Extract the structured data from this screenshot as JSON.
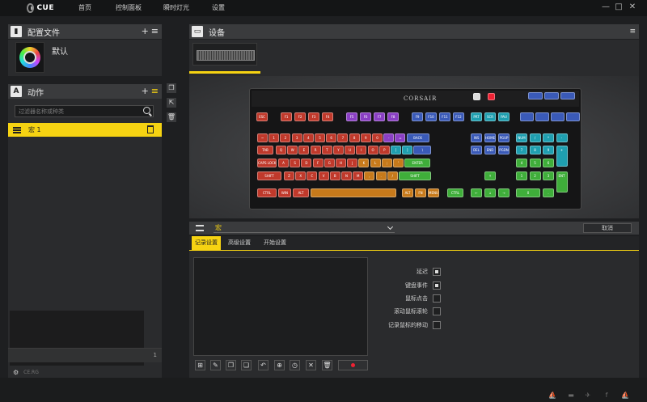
{
  "app": {
    "logo_text": "CUE"
  },
  "nav": {
    "items": [
      "首页",
      "控制面板",
      "瞬时灯光",
      "设置"
    ]
  },
  "window_controls": {
    "minimize": "—",
    "maximize": "□",
    "close": "✕"
  },
  "profiles": {
    "title": "配置文件",
    "add": "+",
    "menu": "≡",
    "selected_profile": "默认"
  },
  "actions": {
    "title": "动作",
    "add": "+",
    "menu": "≡",
    "search_placeholder": "过滤器名称或种类",
    "selected_action": "宏 1",
    "footer_number": "1",
    "footer_label": "CE.RG"
  },
  "devices": {
    "title": "设备",
    "menu": "≡"
  },
  "keyboard": {
    "brand": "CORSAIR",
    "rows": {
      "fn": [
        "ESC",
        "F1",
        "F2",
        "F3",
        "F4",
        "F5",
        "F6",
        "F7",
        "F8",
        "F9",
        "F10",
        "F11",
        "F12",
        "PRT",
        "SCR",
        "PAU"
      ],
      "num": [
        "~",
        "1",
        "2",
        "3",
        "4",
        "5",
        "6",
        "7",
        "8",
        "9",
        "0",
        "-",
        "=",
        "BACK",
        "INS",
        "HOME",
        "PGUP",
        "NUM",
        "/",
        "*",
        "-"
      ],
      "tab": [
        "TAB",
        "Q",
        "W",
        "E",
        "R",
        "T",
        "Y",
        "U",
        "I",
        "O",
        "P",
        "[",
        "]",
        "\\",
        "DEL",
        "END",
        "PGDN",
        "7",
        "8",
        "9",
        "+"
      ],
      "caps": [
        "CAPS LOCK",
        "A",
        "S",
        "D",
        "F",
        "G",
        "H",
        "J",
        "K",
        "L",
        ";",
        "'",
        "ENTER",
        "4",
        "5",
        "6"
      ],
      "shift": [
        "SHIFT",
        "Z",
        "X",
        "C",
        "V",
        "B",
        "N",
        "M",
        ",",
        ".",
        "/",
        "SHIFT",
        "↑",
        "1",
        "2",
        "3",
        "ENT"
      ],
      "ctrl": [
        "CTRL",
        "WIN",
        "ALT",
        "",
        "ALT",
        "FN",
        "MENU",
        "CTRL",
        "←",
        "↓",
        "→",
        "0",
        "."
      ]
    }
  },
  "macro": {
    "name": "宏",
    "cancel": "取消"
  },
  "tabs": [
    "记录设置",
    "高级设置",
    "开始设置"
  ],
  "options": [
    "延迟",
    "键盘事件",
    "鼠标点击",
    "滚动鼠标滚轮",
    "记录鼠标的移动"
  ],
  "colors": {
    "accent": "#f6d312",
    "red": "#c0392b",
    "blue": "#3a5ab8",
    "purple": "#8a3fc4",
    "teal": "#1f9fb0",
    "green": "#3fae3a",
    "orange": "#c77a1b"
  }
}
